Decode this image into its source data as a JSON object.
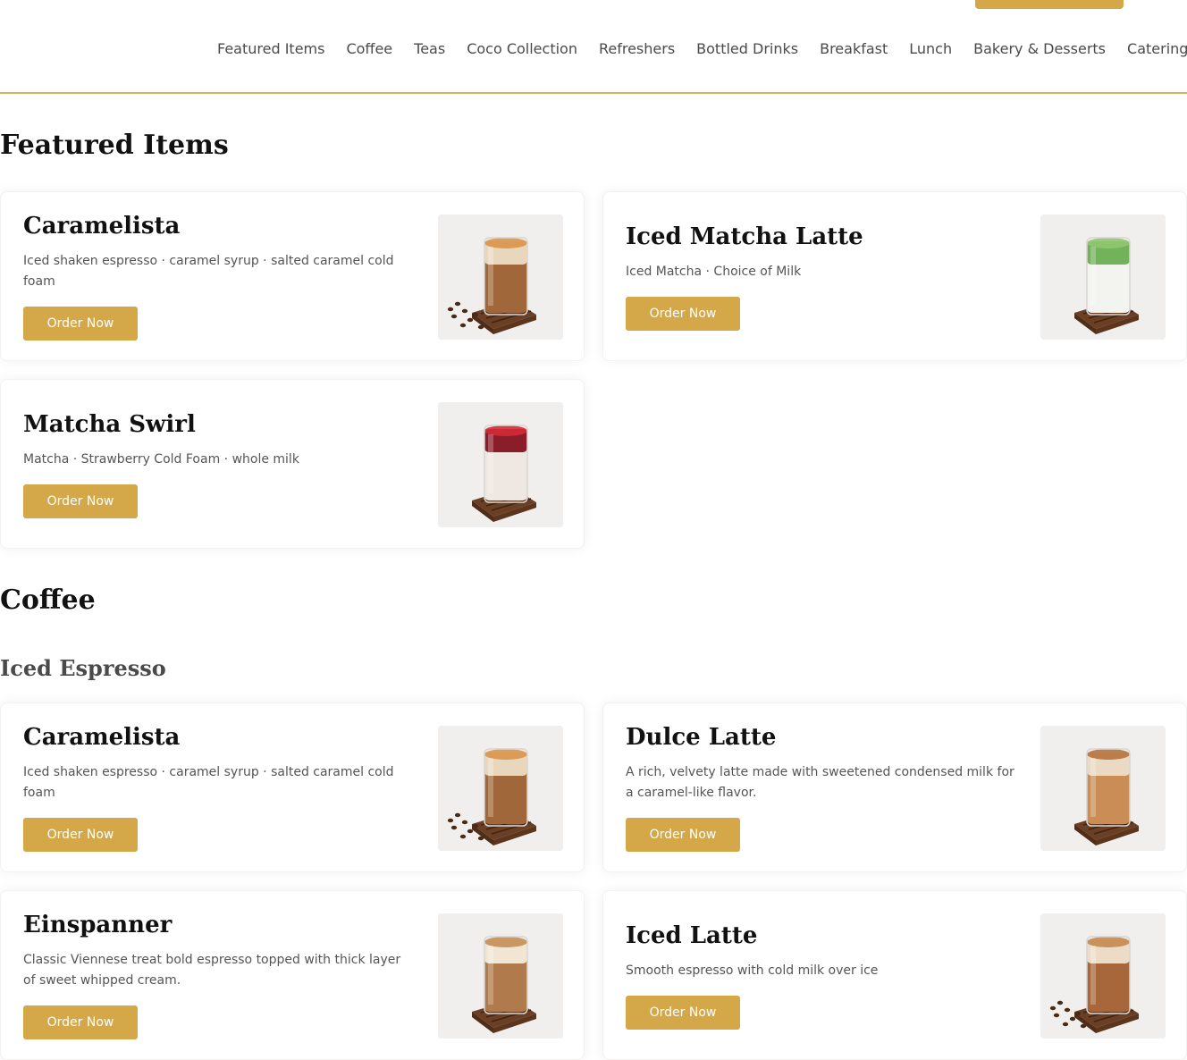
{
  "nav": {
    "items": [
      {
        "label": "Featured Items",
        "id": "featured-items"
      },
      {
        "label": "Coffee",
        "id": "coffee"
      },
      {
        "label": "Teas",
        "id": "teas"
      },
      {
        "label": "Coco Collection",
        "id": "coco-collection"
      },
      {
        "label": "Refreshers",
        "id": "refreshers"
      },
      {
        "label": "Bottled Drinks",
        "id": "bottled-drinks"
      },
      {
        "label": "Breakfast",
        "id": "breakfast"
      },
      {
        "label": "Lunch",
        "id": "lunch"
      },
      {
        "label": "Bakery & Desserts",
        "id": "bakery-desserts"
      },
      {
        "label": "Catering",
        "id": "catering"
      }
    ]
  },
  "colors": {
    "accent": "#d4a748",
    "accent_border": "#d8b25d",
    "heading": "#111111",
    "body_text": "#555555"
  },
  "sections": {
    "featured": {
      "title": "Featured Items",
      "items": [
        {
          "name": "Caramelista",
          "description": "Iced shaken espresso · caramel syrup · salted caramel cold foam",
          "button": "Order Now",
          "image": "caramelista-drink-image"
        },
        {
          "name": "Iced Matcha Latte",
          "description": "Iced Matcha · Choice of Milk",
          "button": "Order Now",
          "image": "iced-matcha-latte-image"
        },
        {
          "name": "Matcha Swirl",
          "description": "Matcha · Strawberry Cold Foam · whole milk",
          "button": "Order Now",
          "image": "matcha-swirl-image"
        }
      ]
    },
    "coffee": {
      "title": "Coffee",
      "subsection": "Iced Espresso",
      "items": [
        {
          "name": "Caramelista",
          "description": "Iced shaken espresso · caramel syrup · salted caramel cold foam",
          "button": "Order Now",
          "image": "caramelista-drink-image"
        },
        {
          "name": "Dulce Latte",
          "description": "A rich, velvety latte made with sweetened condensed milk for a caramel-like flavor.",
          "button": "Order Now",
          "image": "dulce-latte-image"
        },
        {
          "name": "Einspanner",
          "description": "Classic Viennese treat bold espresso topped with thick layer of sweet whipped cream.",
          "button": "Order Now",
          "image": "einspanner-image"
        },
        {
          "name": "Iced Latte",
          "description": "Smooth espresso with cold milk over ice",
          "button": "Order Now",
          "image": "iced-latte-image"
        }
      ]
    }
  }
}
